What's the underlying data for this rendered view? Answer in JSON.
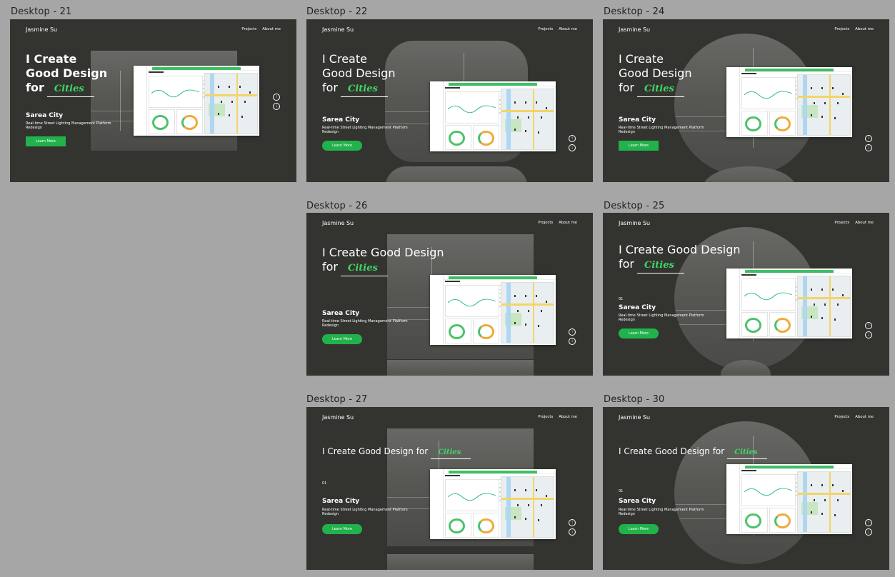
{
  "frames": [
    {
      "id": "f21",
      "label": "Desktop - 21",
      "hero_lines": [
        "I Create",
        "Good Design"
      ],
      "for_word": "for",
      "project_number": ""
    },
    {
      "id": "f22",
      "label": "Desktop - 22",
      "hero_lines": [
        "I Create",
        "Good Design"
      ],
      "for_word": "for",
      "project_number": ""
    },
    {
      "id": "f24",
      "label": "Desktop - 24",
      "hero_lines": [
        "I Create",
        "Good Design"
      ],
      "for_word": "for",
      "project_number": ""
    },
    {
      "id": "f26",
      "label": "Desktop - 26",
      "hero_lines": [
        "I Create Good Design"
      ],
      "for_word": "for",
      "project_number": ""
    },
    {
      "id": "f25",
      "label": "Desktop - 25",
      "hero_lines": [
        "I Create Good Design"
      ],
      "for_word": "for",
      "project_number": "01"
    },
    {
      "id": "f27",
      "label": "Desktop - 27",
      "hero_lines": [],
      "for_word": "I Create Good Design for",
      "project_number": "01"
    },
    {
      "id": "f30",
      "label": "Desktop - 30",
      "hero_lines": [],
      "for_word": "I Create Good Design for",
      "project_number": "01"
    }
  ],
  "site": {
    "brand": "Jasmine Su",
    "nav": [
      "Projects",
      "About me"
    ],
    "highlight_word": "Cities",
    "project_title": "Sarea City",
    "project_subtitle": "Real-time Street Lighting Management Platform Redesign",
    "cta_label": "Learn More",
    "arrow_up": "↑",
    "arrow_down": "↓"
  },
  "colors": {
    "canvas": "#a6a6a6",
    "frame_bg": "#333430",
    "accent_green": "#3fd764",
    "button_green": "#22b24c"
  },
  "icons": [
    "arrow-up-circle-icon",
    "arrow-down-circle-icon"
  ]
}
